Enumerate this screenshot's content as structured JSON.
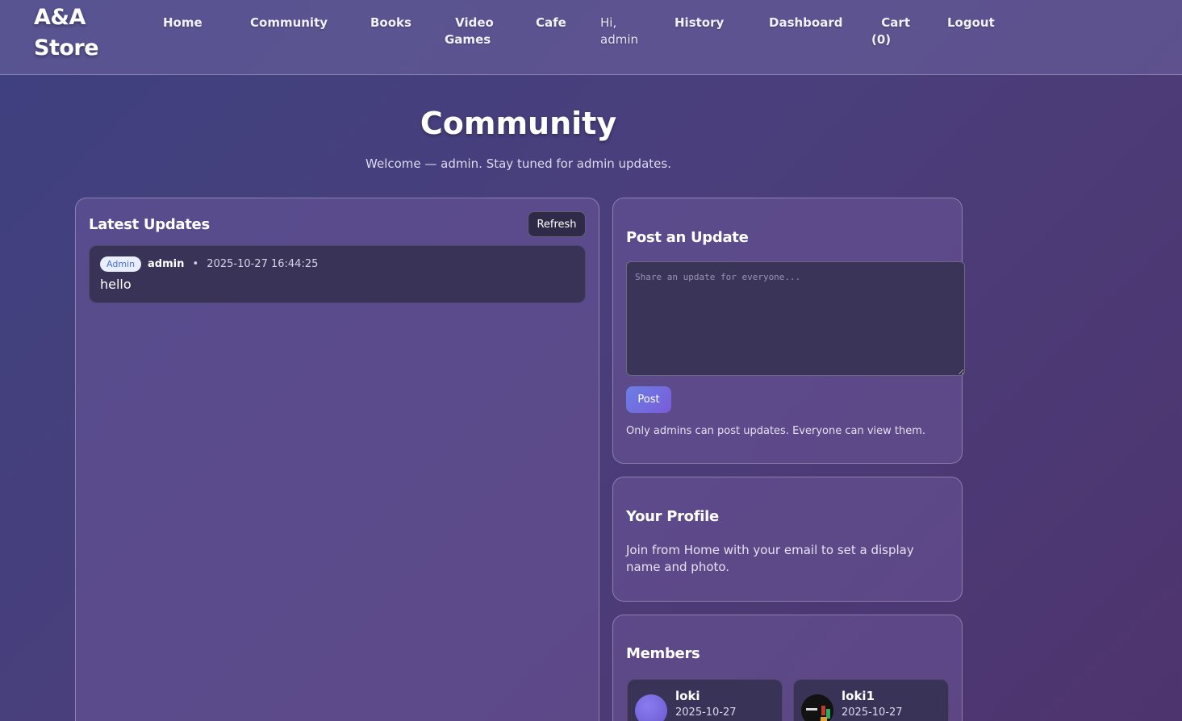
{
  "brand": {
    "line1": "A&A",
    "line2": "Store"
  },
  "nav": {
    "home": "Home",
    "community": "Community",
    "books": "Books",
    "video_games_line1": "Video",
    "video_games_line2": "Games",
    "cafe": "Cafe",
    "greeting_line1": "Hi,",
    "greeting_line2": "admin",
    "history": "History",
    "dashboard": "Dashboard",
    "cart_line1": "Cart",
    "cart_line2": "(0)",
    "logout": "Logout"
  },
  "hero": {
    "title": "Community",
    "subtitle": "Welcome — admin. Stay tuned for admin updates."
  },
  "updates": {
    "title": "Latest Updates",
    "refresh_label": "Refresh",
    "items": [
      {
        "badge": "Admin",
        "author": "admin",
        "separator": "•",
        "timestamp": "2025-10-27 16:44:25",
        "text": "hello"
      }
    ]
  },
  "post": {
    "title": "Post an Update",
    "placeholder": "Share an update for everyone...",
    "value": "",
    "button_label": "Post",
    "note": "Only admins can post updates. Everyone can view them."
  },
  "profile": {
    "title": "Your Profile",
    "text": "Join from Home with your email to set a display name and photo."
  },
  "members": {
    "title": "Members",
    "items": [
      {
        "name": "loki",
        "date": "2025-10-27",
        "avatar_color": "#7f6fe0"
      },
      {
        "name": "loki1",
        "date": "2025-10-27",
        "avatar_color": "#1a1a1a"
      }
    ]
  }
}
